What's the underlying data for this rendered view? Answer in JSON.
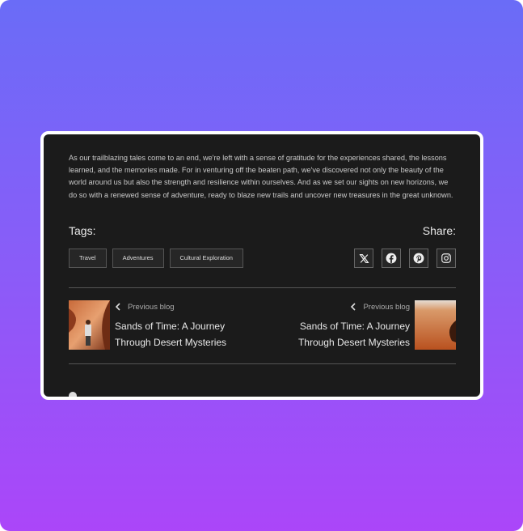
{
  "article": {
    "paragraph": "As our trailblazing tales come to an end, we're left with a sense of gratitude for the experiences shared, the lessons learned, and the memories made. For in venturing off the beaten path, we've discovered not only the beauty of the world around us but also the strength and resilience within ourselves. And as we set our sights on new horizons, we do so with a renewed sense of adventure, ready to blaze new trails and uncover new treasures in the great unknown."
  },
  "tags": {
    "label": "Tags:",
    "items": [
      "Travel",
      "Adventures",
      "Cultural Exploration"
    ]
  },
  "share": {
    "label": "Share:",
    "icons": [
      "x-icon",
      "facebook-icon",
      "pinterest-icon",
      "instagram-icon"
    ]
  },
  "nav": {
    "left": {
      "label": "Previous blog",
      "title": "Sands of Time: A Journey Through Desert Mysteries"
    },
    "right": {
      "label": "Previous blog",
      "title": "Sands of Time: A Journey Through Desert Mysteries"
    }
  },
  "colors": {
    "gradient_top": "#6a6cf7",
    "gradient_bottom": "#ab46f9",
    "card": "#1b1b1b"
  }
}
